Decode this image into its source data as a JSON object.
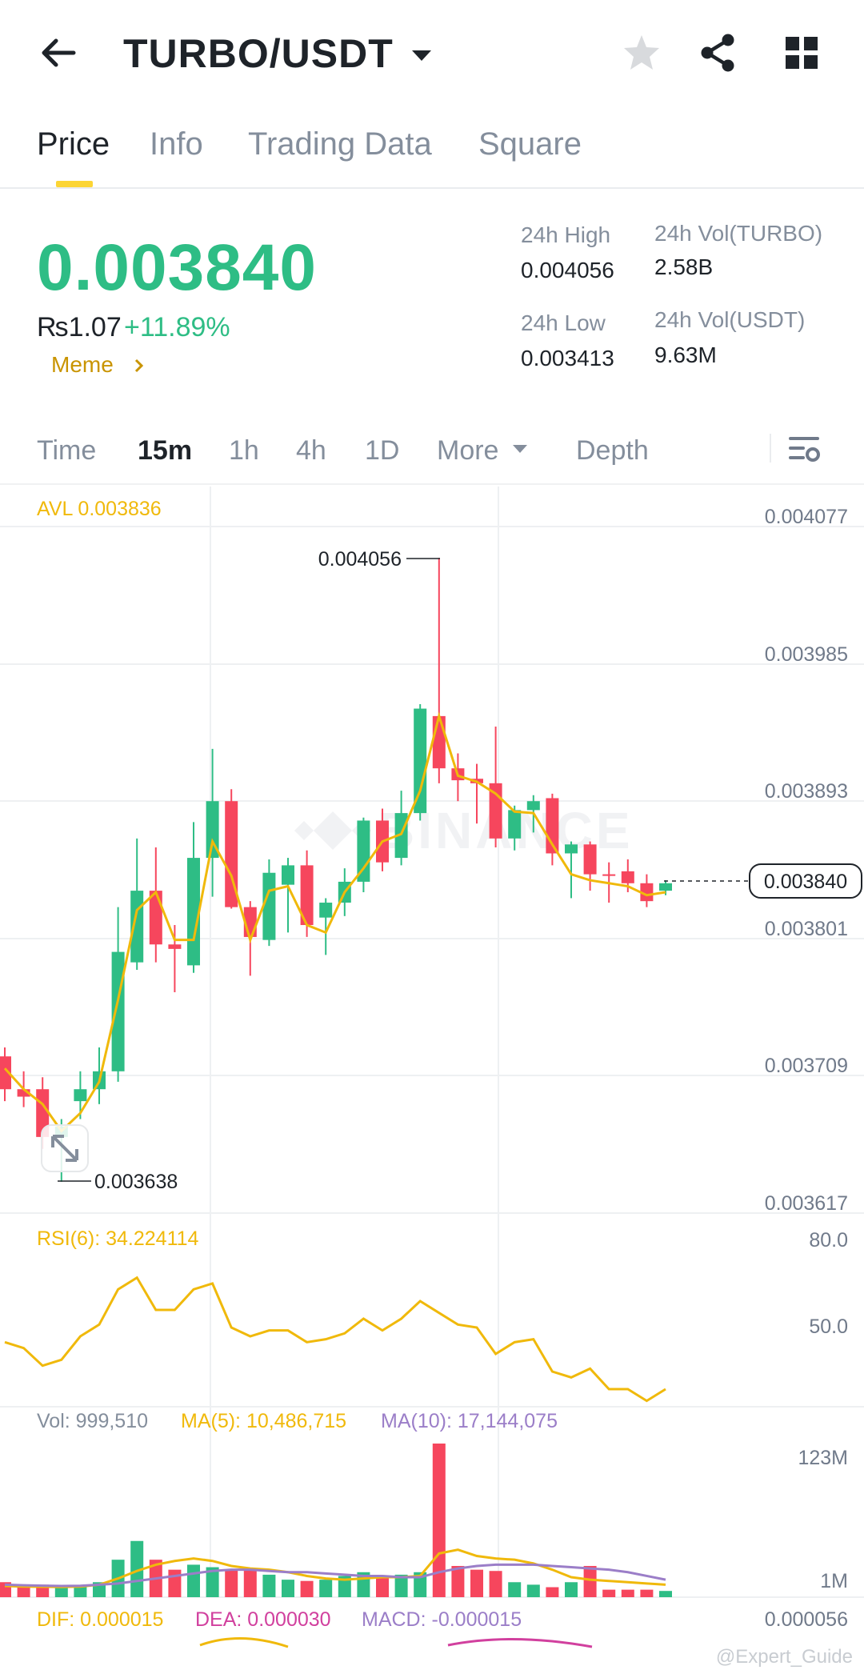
{
  "header": {
    "pair": "TURBO/USDT",
    "icons": [
      "back-arrow-icon",
      "caret-down-icon",
      "star-icon",
      "share-icon",
      "grid-icon"
    ]
  },
  "tabs": [
    "Price",
    "Info",
    "Trading Data",
    "Square"
  ],
  "active_tab": "Price",
  "price": {
    "last": "0.003840",
    "fiat": "₨1.07",
    "change": "+11.89%",
    "tag": "Meme"
  },
  "stats": {
    "high_label": "24h High",
    "high_value": "0.004056",
    "low_label": "24h Low",
    "low_value": "0.003413",
    "vol_base_label": "24h Vol(TURBO)",
    "vol_base_value": "2.58B",
    "vol_quote_label": "24h Vol(USDT)",
    "vol_quote_value": "9.63M"
  },
  "intervals": {
    "items": [
      "Time",
      "15m",
      "1h",
      "4h",
      "1D",
      "More",
      "Depth"
    ],
    "active": "15m"
  },
  "colors": {
    "up": "#2ebd85",
    "down": "#f6465d",
    "accent": "#fcd535",
    "avl": "#f0b90b",
    "ma10": "#9b7ec8",
    "dea": "#d1409e"
  },
  "chart": {
    "avl_label": "AVL 0.003836",
    "price_axis": [
      "0.004077",
      "0.003985",
      "0.003893",
      "0.003801",
      "0.003709",
      "0.003617"
    ],
    "current_price_tag": "0.003840",
    "high_marker": "0.004056",
    "low_marker": "0.003638",
    "rsi_label": "RSI(6): 34.224114",
    "rsi_axis": [
      "80.0",
      "50.0"
    ],
    "vol_label": "Vol: 999,510",
    "vol_ma5_label": "MA(5): 10,486,715",
    "vol_ma10_label": "MA(10): 17,144,075",
    "vol_axis": [
      "123M",
      "1M"
    ],
    "macd_dif": "DIF: 0.000015",
    "macd_dea": "DEA: 0.000030",
    "macd_value": "MACD: -0.000015",
    "macd_axis": "0.000056",
    "watermark": "BINANCE",
    "credit": "@Expert_Guide"
  },
  "chart_data": {
    "type": "candlestick",
    "interval": "15m",
    "ylim": [
      0.003617,
      0.004077
    ],
    "candles": [
      {
        "o": 0.003722,
        "h": 0.003728,
        "l": 0.003692,
        "c": 0.0037
      },
      {
        "o": 0.0037,
        "h": 0.003712,
        "l": 0.003688,
        "c": 0.003695
      },
      {
        "o": 0.0037,
        "h": 0.003708,
        "l": 0.00366,
        "c": 0.003668
      },
      {
        "o": 0.003668,
        "h": 0.00368,
        "l": 0.003638,
        "c": 0.003675
      },
      {
        "o": 0.003692,
        "h": 0.003712,
        "l": 0.00368,
        "c": 0.0037
      },
      {
        "o": 0.0037,
        "h": 0.003728,
        "l": 0.00369,
        "c": 0.003712
      },
      {
        "o": 0.003712,
        "h": 0.003822,
        "l": 0.003705,
        "c": 0.003792
      },
      {
        "o": 0.003785,
        "h": 0.003868,
        "l": 0.00378,
        "c": 0.003833
      },
      {
        "o": 0.003833,
        "h": 0.003862,
        "l": 0.003785,
        "c": 0.003797
      },
      {
        "o": 0.003797,
        "h": 0.00381,
        "l": 0.003765,
        "c": 0.003794
      },
      {
        "o": 0.003783,
        "h": 0.003879,
        "l": 0.003778,
        "c": 0.003855
      },
      {
        "o": 0.003855,
        "h": 0.003928,
        "l": 0.003829,
        "c": 0.003893
      },
      {
        "o": 0.003893,
        "h": 0.003901,
        "l": 0.003821,
        "c": 0.003822
      },
      {
        "o": 0.003822,
        "h": 0.003826,
        "l": 0.003776,
        "c": 0.003802
      },
      {
        "o": 0.0038,
        "h": 0.003854,
        "l": 0.003796,
        "c": 0.003845
      },
      {
        "o": 0.003837,
        "h": 0.003855,
        "l": 0.003805,
        "c": 0.00385
      },
      {
        "o": 0.00385,
        "h": 0.00386,
        "l": 0.003802,
        "c": 0.00381
      },
      {
        "o": 0.003815,
        "h": 0.003828,
        "l": 0.00379,
        "c": 0.003825
      },
      {
        "o": 0.003825,
        "h": 0.003848,
        "l": 0.003816,
        "c": 0.003839
      },
      {
        "o": 0.003839,
        "h": 0.003882,
        "l": 0.003832,
        "c": 0.00388
      },
      {
        "o": 0.00388,
        "h": 0.003888,
        "l": 0.003846,
        "c": 0.003852
      },
      {
        "o": 0.003855,
        "h": 0.0039,
        "l": 0.00385,
        "c": 0.003885
      },
      {
        "o": 0.003885,
        "h": 0.003958,
        "l": 0.00388,
        "c": 0.003955
      },
      {
        "o": 0.00395,
        "h": 0.004056,
        "l": 0.003905,
        "c": 0.003915
      },
      {
        "o": 0.003915,
        "h": 0.003925,
        "l": 0.003893,
        "c": 0.003907
      },
      {
        "o": 0.003908,
        "h": 0.003918,
        "l": 0.003878,
        "c": 0.003905
      },
      {
        "o": 0.003905,
        "h": 0.003943,
        "l": 0.003862,
        "c": 0.003868
      },
      {
        "o": 0.003868,
        "h": 0.00389,
        "l": 0.00386,
        "c": 0.003887
      },
      {
        "o": 0.003887,
        "h": 0.003897,
        "l": 0.003872,
        "c": 0.003893
      },
      {
        "o": 0.003895,
        "h": 0.003898,
        "l": 0.00385,
        "c": 0.003858
      },
      {
        "o": 0.003858,
        "h": 0.003866,
        "l": 0.003828,
        "c": 0.003864
      },
      {
        "o": 0.003864,
        "h": 0.003866,
        "l": 0.003833,
        "c": 0.003844
      },
      {
        "o": 0.003844,
        "h": 0.003852,
        "l": 0.003825,
        "c": 0.003843
      },
      {
        "o": 0.003846,
        "h": 0.003854,
        "l": 0.003832,
        "c": 0.003838
      },
      {
        "o": 0.003838,
        "h": 0.003844,
        "l": 0.003822,
        "c": 0.003826
      },
      {
        "o": 0.003833,
        "h": 0.00384,
        "l": 0.00383,
        "c": 0.003838
      }
    ],
    "ma_avl": [
      0.003714,
      0.0037,
      0.00369,
      0.003672,
      0.003684,
      0.003705,
      0.00376,
      0.00382,
      0.003832,
      0.0038,
      0.0038,
      0.003866,
      0.003843,
      0.0038,
      0.003833,
      0.003836,
      0.00381,
      0.003805,
      0.003832,
      0.003848,
      0.003866,
      0.003871,
      0.0039,
      0.00395,
      0.00391,
      0.003906,
      0.003898,
      0.003886,
      0.003885,
      0.003864,
      0.003844,
      0.00384,
      0.003838,
      0.003836,
      0.00383,
      0.003832
    ],
    "rsi6": [
      52,
      50,
      44,
      46,
      54,
      58,
      70,
      74,
      63,
      63,
      70,
      72,
      57,
      54,
      56,
      56,
      52,
      53,
      55,
      60,
      56,
      60,
      66,
      62,
      58,
      57,
      48,
      52,
      53,
      42,
      40,
      43,
      36,
      36,
      32,
      36
    ],
    "rsi_ylim": [
      30,
      90
    ],
    "volume": [
      12,
      8,
      10,
      8,
      9,
      12,
      30,
      45,
      30,
      22,
      26,
      24,
      22,
      22,
      18,
      14,
      13,
      14,
      17,
      20,
      16,
      18,
      20,
      123,
      25,
      22,
      21,
      12,
      10,
      8,
      12,
      25,
      6,
      6,
      6,
      5
    ],
    "volume_ma5": [
      9,
      8.5,
      8.3,
      8.2,
      8.5,
      10,
      15,
      21,
      26,
      29,
      31,
      29,
      25,
      23,
      22,
      20,
      17,
      15,
      14,
      15,
      16,
      16,
      17,
      35,
      38,
      33,
      31,
      30,
      27,
      22,
      16,
      14,
      13,
      12,
      11,
      10
    ],
    "volume_ma10": [
      10,
      9.5,
      9.2,
      9.0,
      9.1,
      10,
      11,
      13,
      15,
      17,
      19,
      21,
      22,
      22,
      21,
      20,
      20,
      19,
      18,
      17,
      17,
      16,
      16,
      20,
      23,
      25,
      26,
      26,
      26,
      25,
      24,
      23,
      22,
      20,
      17,
      14
    ],
    "volume_ylim": [
      0,
      123
    ]
  }
}
